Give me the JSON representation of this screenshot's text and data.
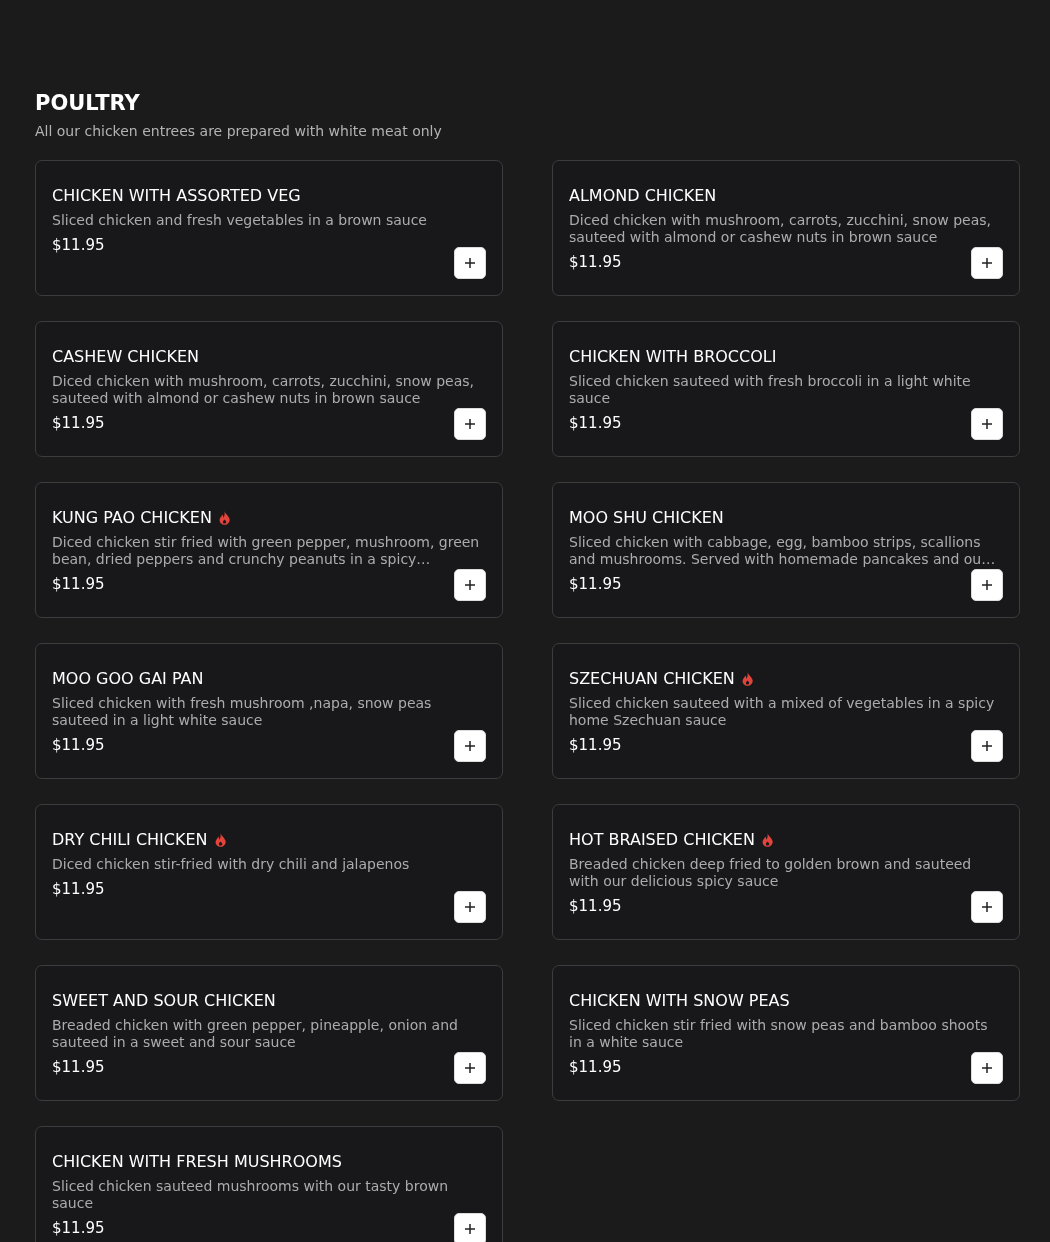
{
  "section": {
    "title": "POULTRY",
    "subtitle": "All our chicken entrees are prepared with white meat only"
  },
  "items": [
    {
      "name": "CHICKEN WITH ASSORTED VEG",
      "spicy": false,
      "description": "Sliced chicken and fresh vegetables in a brown sauce",
      "price": "$11.95"
    },
    {
      "name": "ALMOND CHICKEN",
      "spicy": false,
      "description": "Diced chicken with mushroom, carrots, zucchini, snow peas, sauteed with almond or cashew nuts in brown sauce",
      "price": "$11.95"
    },
    {
      "name": "CASHEW CHICKEN",
      "spicy": false,
      "description": "Diced chicken with mushroom, carrots, zucchini, snow peas, sauteed with almond or cashew nuts in brown sauce",
      "price": "$11.95"
    },
    {
      "name": "CHICKEN WITH BROCCOLI",
      "spicy": false,
      "description": "Sliced chicken sauteed with fresh broccoli in a light white sauce",
      "price": "$11.95"
    },
    {
      "name": "KUNG PAO CHICKEN",
      "spicy": true,
      "description": "Diced chicken stir fried with green pepper, mushroom, green bean, dried peppers and crunchy peanuts in a spicy…",
      "price": "$11.95"
    },
    {
      "name": "MOO SHU CHICKEN",
      "spicy": false,
      "description": "Sliced chicken with cabbage, egg, bamboo strips, scallions and mushrooms. Served with homemade pancakes and ou…",
      "price": "$11.95"
    },
    {
      "name": "MOO GOO GAI PAN",
      "spicy": false,
      "description": "Sliced chicken with fresh mushroom ,napa, snow peas sauteed in a light white sauce",
      "price": "$11.95"
    },
    {
      "name": "SZECHUAN CHICKEN",
      "spicy": true,
      "description": "Sliced chicken sauteed with a mixed of vegetables in a spicy home Szechuan sauce",
      "price": "$11.95"
    },
    {
      "name": "DRY CHILI CHICKEN",
      "spicy": true,
      "description": "Diced chicken stir-fried with dry chili and jalapenos",
      "price": "$11.95"
    },
    {
      "name": "HOT BRAISED CHICKEN",
      "spicy": true,
      "description": "Breaded chicken deep fried to golden brown and sauteed with our delicious spicy sauce",
      "price": "$11.95"
    },
    {
      "name": "SWEET AND SOUR CHICKEN",
      "spicy": false,
      "description": "Breaded chicken with green pepper, pineapple, onion and sauteed in a sweet and sour sauce",
      "price": "$11.95"
    },
    {
      "name": "CHICKEN WITH SNOW PEAS",
      "spicy": false,
      "description": "Sliced chicken stir fried with snow peas and bamboo shoots in a white sauce",
      "price": "$11.95"
    },
    {
      "name": "CHICKEN WITH FRESH MUSHROOMS",
      "spicy": false,
      "description": "Sliced chicken sauteed mushrooms with our tasty brown sauce",
      "price": "$11.95"
    }
  ]
}
